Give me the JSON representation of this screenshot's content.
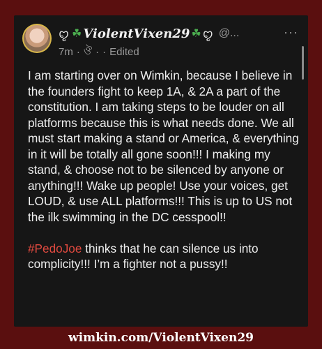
{
  "post": {
    "author": {
      "decoration_left": "ꨄ",
      "clover_left": "☘",
      "display_name": "ViolentVixen29",
      "clover_right": "☘",
      "decoration_right": "ꨄ",
      "handle": "@..."
    },
    "meta": {
      "time": "7m",
      "separator1": "·",
      "visibility_icon": "globe-icon",
      "visibility_glyph": "ঔ",
      "separator2": "·",
      "separator3": "·",
      "edited": "Edited"
    },
    "more_label": "···",
    "paragraph1": "I am starting over on Wimkin, because I believe in the founders fight to keep 1A, & 2A a part of the constitution. I am taking steps to be louder on all platforms because this is what needs done. We all must start making a stand or America, & everything in it will be totally all gone soon!!! I making my stand, & choose not to be silenced by anyone or anything!!! Wake up people! Use your voices, get LOUD, & use ALL platforms!!! This is up to US not the ilk swimming in the DC cesspool!!",
    "hashtag": "#PedoJoe",
    "paragraph2_rest": " thinks that he can silence us into complicity!!! I’m a fighter not a pussy!!"
  },
  "footer": {
    "watermark": "wimkin.com/ViolentVixen29"
  },
  "colors": {
    "background": "#5a0f0f",
    "card": "#161616",
    "hashtag": "#e0493f",
    "clover": "#4caf50"
  }
}
